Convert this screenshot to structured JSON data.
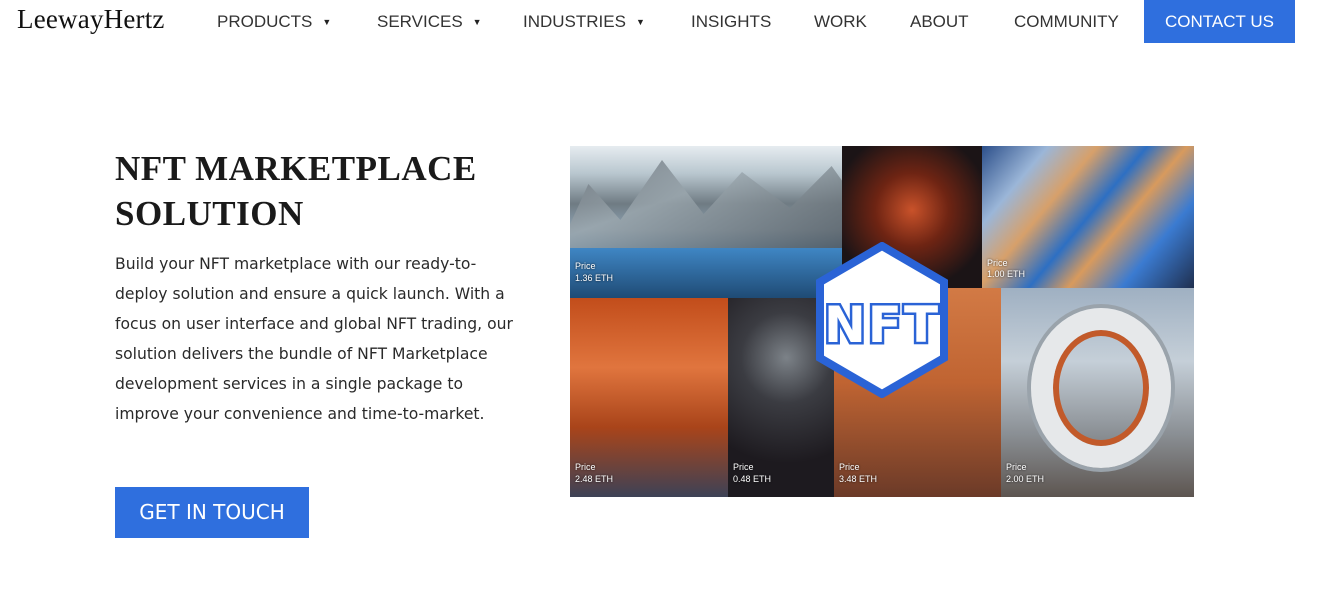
{
  "header": {
    "logo": "LeewayHertz",
    "nav": [
      {
        "label": "PRODUCTS",
        "dropdown": true
      },
      {
        "label": "SERVICES",
        "dropdown": true
      },
      {
        "label": "INDUSTRIES",
        "dropdown": true
      },
      {
        "label": "INSIGHTS",
        "dropdown": false
      },
      {
        "label": "WORK",
        "dropdown": false
      },
      {
        "label": "ABOUT",
        "dropdown": false
      },
      {
        "label": "COMMUNITY",
        "dropdown": false
      }
    ],
    "cta_label": "CONTACT US"
  },
  "hero": {
    "title": "NFT MARKETPLACE SOLUTION",
    "description": "Build your NFT marketplace with our ready-to-deploy solution and ensure a quick launch. With a focus on user interface and global NFT trading, our solution delivers the bundle of NFT Marketplace development services in a single package to improve your convenience and time-to-market.",
    "button_label": "GET IN TOUCH"
  },
  "collage": {
    "badge_text": "NFT",
    "tiles": [
      {
        "price_label": "Price",
        "price": "1.36 ETH"
      },
      {
        "price_label": "Price",
        "price": "1.00 ETH"
      },
      {
        "price_label": "Price",
        "price": "2.48 ETH"
      },
      {
        "price_label": "Price",
        "price": "0.48 ETH"
      },
      {
        "price_label": "Price",
        "price": "3.48 ETH"
      },
      {
        "price_label": "Price",
        "price": "2.00 ETH"
      }
    ]
  },
  "colors": {
    "accent": "#2f6fde",
    "badge_blue": "#2a63d6"
  }
}
